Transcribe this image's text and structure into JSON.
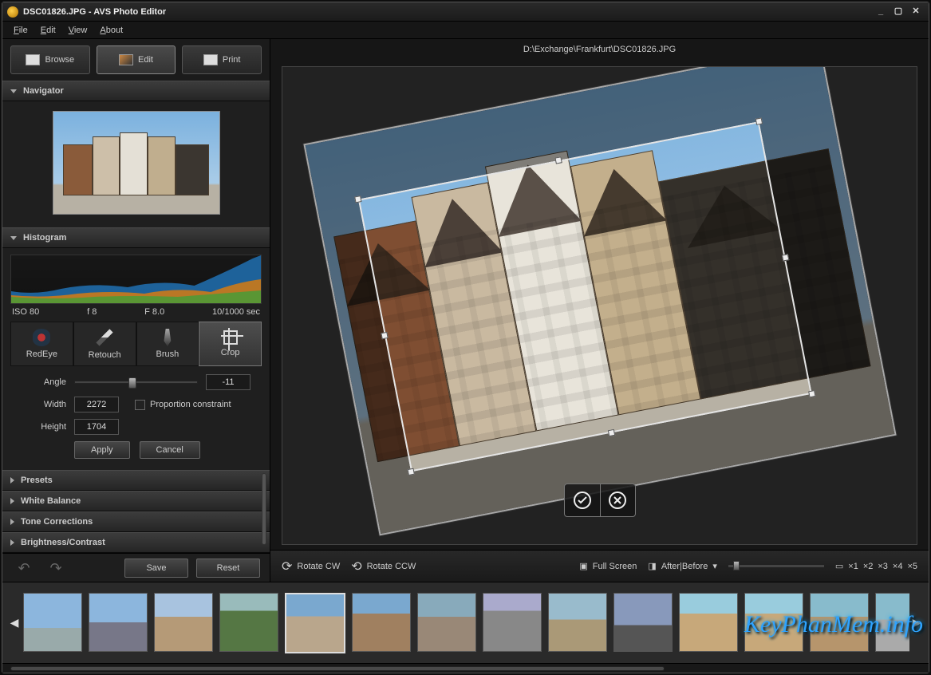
{
  "app": {
    "title": "DSC01826.JPG  -  AVS Photo Editor"
  },
  "menu": {
    "file": "File",
    "edit": "Edit",
    "view": "View",
    "about": "About"
  },
  "modes": {
    "browse": "Browse",
    "edit": "Edit",
    "print": "Print"
  },
  "sidebar": {
    "navigator": "Navigator",
    "histogram": "Histogram",
    "meta": {
      "iso": "ISO 80",
      "focal": "f 8",
      "aperture": "F 8.0",
      "shutter": "10/1000 sec"
    },
    "tools": {
      "redeye": "RedEye",
      "retouch": "Retouch",
      "brush": "Brush",
      "crop": "Crop"
    },
    "crop": {
      "angle_label": "Angle",
      "angle_value": "-11",
      "width_label": "Width",
      "width_value": "2272",
      "height_label": "Height",
      "height_value": "1704",
      "proportion": "Proportion constraint",
      "apply": "Apply",
      "cancel": "Cancel"
    },
    "panels": {
      "presets": "Presets",
      "white_balance": "White Balance",
      "tone": "Tone Corrections",
      "brightness": "Brightness/Contrast"
    },
    "save": "Save",
    "reset": "Reset"
  },
  "main": {
    "path": "D:\\Exchange\\Frankfurt\\DSC01826.JPG",
    "rotate_cw": "Rotate CW",
    "rotate_ccw": "Rotate CCW",
    "full_screen": "Full Screen",
    "after_before": "After|Before",
    "zooms": [
      "×1",
      "×2",
      "×3",
      "×4",
      "×5"
    ]
  },
  "watermark": "KeyPhanMem.info"
}
